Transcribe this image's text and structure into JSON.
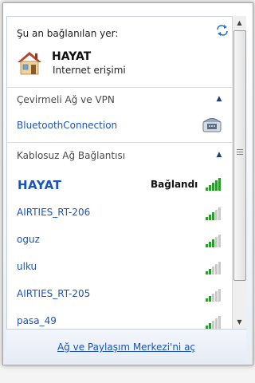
{
  "current": {
    "header": "Şu an bağlanılan yer:",
    "name": "HAYAT",
    "status": "Internet erişimi"
  },
  "dialup": {
    "title": "Çevirmeli Ağ ve VPN",
    "items": [
      {
        "name": "BluetoothConnection"
      }
    ]
  },
  "wireless": {
    "title": "Kablosuz Ağ Bağlantısı",
    "connected": {
      "name": "HAYAT",
      "status": "Bağlandı",
      "signal": 5
    },
    "networks": [
      {
        "name": "AIRTIES_RT-206",
        "signal": 3
      },
      {
        "name": "oguz",
        "signal": 3
      },
      {
        "name": "ulku",
        "signal": 2
      },
      {
        "name": "AIRTIES_RT-205",
        "signal": 2
      },
      {
        "name": "pasa_49",
        "signal": 2
      }
    ]
  },
  "footer": {
    "link": "Ağ ve Paylaşım Merkezi'ni aç"
  },
  "colors": {
    "link": "#1a54b7",
    "signal_active": "#2f9a2f",
    "signal_inactive": "#c9c9c9"
  }
}
